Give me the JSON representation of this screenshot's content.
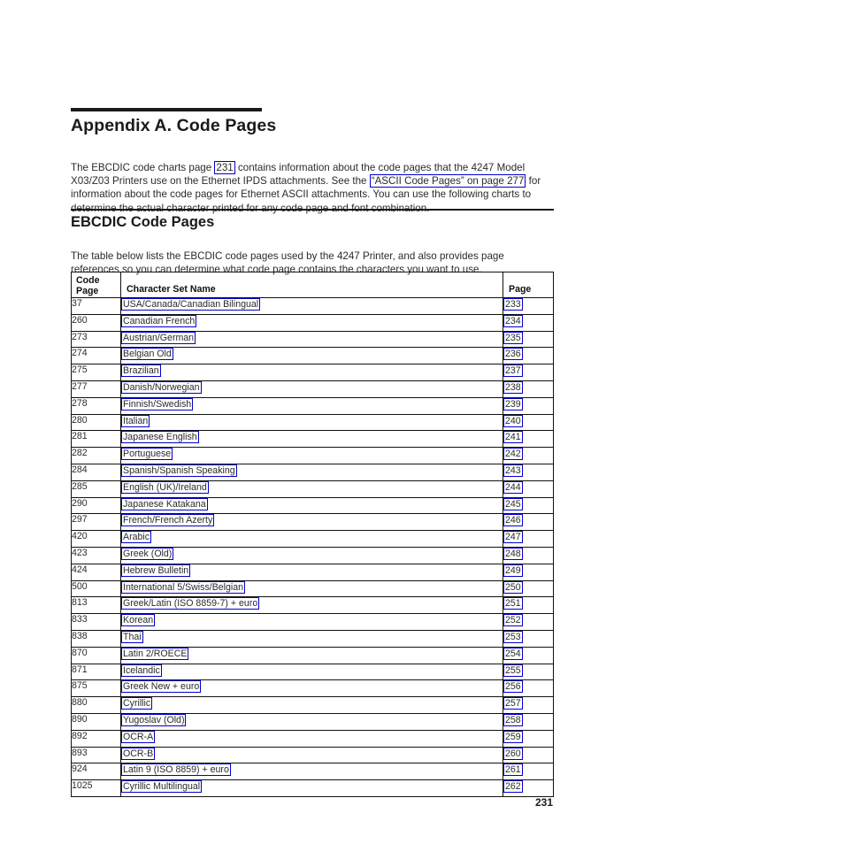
{
  "document": {
    "appendix_rule": true,
    "appendix_title": "Appendix A. Code Pages",
    "intro_paragraph": {
      "part1": "The EBCDIC code charts page ",
      "link1": "231",
      "part2": " contains information about the code pages that the 4247 Model X03/Z03 Printers use on the Ethernet IPDS attachments. See the ",
      "link2": "“ASCII Code Pages” on page 277",
      "part3": " for information about the code pages for Ethernet ASCII attachments. You can use the following charts to determine the actual character printed for any code page and font combination."
    },
    "section": {
      "title": "EBCDIC Code Pages",
      "paragraph": "The table below lists the EBCDIC code pages used by the 4247 Printer, and also provides page references so you can determine what code page contains the characters you want to use."
    },
    "table": {
      "headers": {
        "code_page": "Code\nPage",
        "code_page_line1": "Code",
        "code_page_line2": "Page",
        "character_set_name": "Character Set Name",
        "page": "Page"
      },
      "rows": [
        {
          "code": "37",
          "name": "USA/Canada/Canadian Bilingual",
          "page": "233"
        },
        {
          "code": "260",
          "name": "Canadian French",
          "page": "234"
        },
        {
          "code": "273",
          "name": "Austrian/German",
          "page": "235"
        },
        {
          "code": "274",
          "name": "Belgian Old",
          "page": "236"
        },
        {
          "code": "275",
          "name": "Brazilian",
          "page": "237"
        },
        {
          "code": "277",
          "name": "Danish/Norwegian",
          "page": "238"
        },
        {
          "code": "278",
          "name": "Finnish/Swedish",
          "page": "239"
        },
        {
          "code": "280",
          "name": "Italian",
          "page": "240"
        },
        {
          "code": "281",
          "name": "Japanese English",
          "page": "241"
        },
        {
          "code": "282",
          "name": "Portuguese",
          "page": "242"
        },
        {
          "code": "284",
          "name": "Spanish/Spanish Speaking",
          "page": "243"
        },
        {
          "code": "285",
          "name": "English (UK)/Ireland",
          "page": "244"
        },
        {
          "code": "290",
          "name": "Japanese Katakana",
          "page": "245"
        },
        {
          "code": "297",
          "name": "French/French Azerty",
          "page": "246"
        },
        {
          "code": "420",
          "name": "Arabic",
          "page": "247"
        },
        {
          "code": "423",
          "name": "Greek (Old)",
          "page": "248"
        },
        {
          "code": "424",
          "name": "Hebrew Bulletin",
          "page": "249"
        },
        {
          "code": "500",
          "name": "International 5/Swiss/Belgian",
          "page": "250"
        },
        {
          "code": "813",
          "name": "Greek/Latin (ISO 8859-7) + euro",
          "page": "251"
        },
        {
          "code": "833",
          "name": "Korean",
          "page": "252"
        },
        {
          "code": "838",
          "name": "Thai",
          "page": "253"
        },
        {
          "code": "870",
          "name": "Latin 2/ROECE",
          "page": "254"
        },
        {
          "code": "871",
          "name": "Icelandic",
          "page": "255"
        },
        {
          "code": "875",
          "name": "Greek New + euro",
          "page": "256"
        },
        {
          "code": "880",
          "name": "Cyrillic",
          "page": "257"
        },
        {
          "code": "890",
          "name": "Yugoslav (Old)",
          "page": "258"
        },
        {
          "code": "892",
          "name": "OCR-A",
          "page": "259"
        },
        {
          "code": "893",
          "name": "OCR-B",
          "page": "260"
        },
        {
          "code": "924",
          "name": "Latin 9 (ISO 8859) + euro",
          "page": "261"
        },
        {
          "code": "1025",
          "name": "Cyrillic Multilingual",
          "page": "262"
        }
      ]
    },
    "folio": "231",
    "colors": {
      "link_border": "#0000cc",
      "text": "#2b2b2b",
      "rule": "#1a1a1a",
      "table_border": "#111111"
    }
  }
}
